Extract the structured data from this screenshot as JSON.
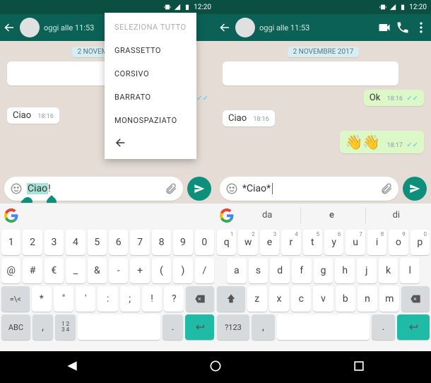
{
  "statusbar": {
    "time": "12:20"
  },
  "header": {
    "last_seen": "oggi alle 11:53"
  },
  "chat": {
    "date_label": "2 NOVEMBRE 2017",
    "in1_text": "Ciao",
    "in1_time": "18:16",
    "out_ok": "Ok",
    "out_ok_time": "18:16",
    "out_emoji": "👋👋",
    "out_emoji_time": "18:17"
  },
  "input": {
    "left_value_pre": "",
    "left_value_sel": "Ciao",
    "left_value_post": "!",
    "right_value": "*Ciao*"
  },
  "ctx": {
    "item0": "SELEZIONA TUTTO",
    "item1": "GRASSETTO",
    "item2": "CORSIVO",
    "item3": "BARRATO",
    "item4": "MONOSPAZIATO"
  },
  "suggest_right": {
    "s1": "da",
    "s2": "e",
    "s3": "di"
  },
  "kb_left": {
    "r1": [
      "1",
      "2",
      "3",
      "4",
      "5",
      "6",
      "7",
      "8",
      "9",
      "0"
    ],
    "r2": [
      "@",
      "#",
      "€",
      "_",
      "&",
      "-",
      "+",
      "(",
      ")",
      "/"
    ],
    "r3": [
      "*",
      "\"",
      "'",
      ":",
      ";",
      "!",
      "?"
    ],
    "shift": "=\\<",
    "mode": "ABC",
    "num": "12\n34",
    "comma": ",",
    "dot": "."
  },
  "kb_right": {
    "r1": [
      "q",
      "w",
      "e",
      "r",
      "t",
      "y",
      "u",
      "i",
      "o",
      "p"
    ],
    "r1sup": [
      "1",
      "2",
      "3",
      "4",
      "5",
      "6",
      "7",
      "8",
      "9",
      "0"
    ],
    "r2": [
      "a",
      "s",
      "d",
      "f",
      "g",
      "h",
      "j",
      "k",
      "l"
    ],
    "r3": [
      "z",
      "x",
      "c",
      "v",
      "b",
      "n",
      "m"
    ],
    "mode": "?123",
    "comma": ",",
    "dot": "."
  }
}
